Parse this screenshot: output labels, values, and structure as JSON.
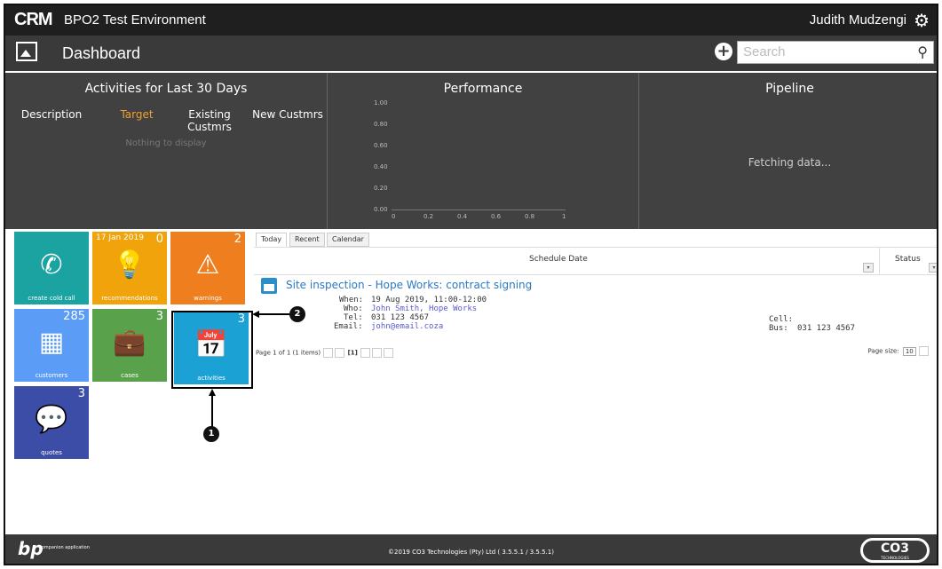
{
  "header": {
    "logo": "CRM",
    "environment": "BPO2 Test Environment",
    "user": "Judith Mudzengi"
  },
  "dashboard": {
    "title": "Dashboard",
    "search_placeholder": "Search"
  },
  "panels": {
    "activities": {
      "title": "Activities for Last 30 Days",
      "columns": [
        "Description",
        "Target",
        "Existing Custmrs",
        "New Custmrs"
      ],
      "empty": "Nothing to display"
    },
    "performance": {
      "title": "Performance",
      "y_ticks": [
        "1.00",
        "0.80",
        "0.60",
        "0.40",
        "0.20",
        "0.00"
      ],
      "x_ticks": [
        "0",
        "0.2",
        "0.4",
        "0.6",
        "0.8",
        "1"
      ]
    },
    "pipeline": {
      "title": "Pipeline",
      "status": "Fetching data..."
    }
  },
  "tiles": [
    {
      "label": "create cold call",
      "count": "",
      "date": "",
      "color": "#1aa3a0"
    },
    {
      "label": "recommendations",
      "count": "0",
      "date": "17 Jan 2019",
      "color": "#f0a30a"
    },
    {
      "label": "warnings",
      "count": "2",
      "date": "",
      "color": "#ef7e1f"
    },
    {
      "label": "customers",
      "count": "285",
      "date": "",
      "color": "#5b9cf6"
    },
    {
      "label": "cases",
      "count": "3",
      "date": "",
      "color": "#5aa14c"
    },
    {
      "label": "activities",
      "count": "3",
      "date": "",
      "color": "#1ba1d4"
    },
    {
      "label": "quotes",
      "count": "3",
      "date": "",
      "color": "#3b4da6"
    }
  ],
  "tabs": [
    "Today",
    "Recent",
    "Calendar"
  ],
  "grid": {
    "headers": {
      "schedule_date": "Schedule Date",
      "status": "Status"
    },
    "item": {
      "title": "Site inspection - Hope Works: contract signing",
      "when_label": "When:",
      "when": "19 Aug 2019, 11:00-12:00",
      "who_label": "Who:",
      "who": "John Smith, Hope Works",
      "tel_label": "Tel:",
      "tel": "031 123 4567",
      "email_label": "Email:",
      "email": "john@email.coza",
      "cell_label": "Cell:",
      "cell": "",
      "bus_label": "Bus:",
      "bus": "031 123 4567"
    },
    "pager": {
      "text": "Page 1 of 1 (1 items)",
      "current": "[1]",
      "page_size_label": "Page size:",
      "page_size": "10"
    }
  },
  "callouts": [
    "1",
    "2"
  ],
  "footer": {
    "logo": "bp",
    "logo_sub": "companion application",
    "copyright": "©2019 CO3 Technologies (Pty) Ltd ( 3.5.5.1 / 3.5.5.1)",
    "brand": "CO3",
    "brand_sub": "TECHNOLOGIES"
  }
}
